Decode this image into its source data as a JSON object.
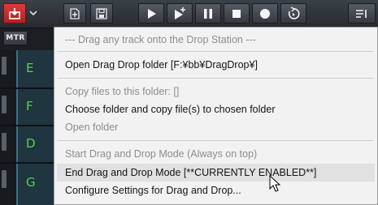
{
  "toolbar": {
    "items": [
      {
        "name": "drag-drop-station-button",
        "icon": "drag-drop-icon",
        "color": "#d12d30"
      },
      {
        "name": "menu-chevron-button",
        "icon": "chevron-down-icon"
      },
      {
        "name": "add-file-button",
        "icon": "add-file-icon"
      },
      {
        "name": "save-button",
        "icon": "save-icon"
      },
      {
        "name": "play-button",
        "icon": "play-icon"
      },
      {
        "name": "play-from-cursor-button",
        "icon": "play-sparkle-icon"
      },
      {
        "name": "pause-button",
        "icon": "pause-icon"
      },
      {
        "name": "stop-button",
        "icon": "stop-icon"
      },
      {
        "name": "record-button",
        "icon": "record-icon"
      },
      {
        "name": "loop-button",
        "icon": "loop-icon"
      },
      {
        "name": "tracks-view-button",
        "icon": "list-icon"
      }
    ]
  },
  "left_strip": {
    "mtr_label": "MTR",
    "tracks": [
      {
        "letter": "E"
      },
      {
        "letter": "F"
      },
      {
        "letter": "D"
      },
      {
        "letter": "G"
      }
    ]
  },
  "menu": {
    "header": "--- Drag any track onto the Drop Station ---",
    "open_folder": "Open Drag Drop folder [F:¥bb¥DragDrop¥]",
    "copy_files": "Copy files to this folder: []",
    "choose_folder": "Choose folder and copy file(s) to chosen folder",
    "open_folder_plain": "Open folder",
    "start_mode": "Start Drag and Drop Mode (Always on top)",
    "end_mode": "End Drag and Drop Mode [**CURRENTLY ENABLED**]",
    "configure": "Configure Settings for Drag and Drop..."
  },
  "colors": {
    "accent_red": "#d12d30",
    "track_green": "#5bd04f",
    "menu_bg": "#f2f2f2",
    "menu_disabled_text": "#8d8d8d"
  }
}
